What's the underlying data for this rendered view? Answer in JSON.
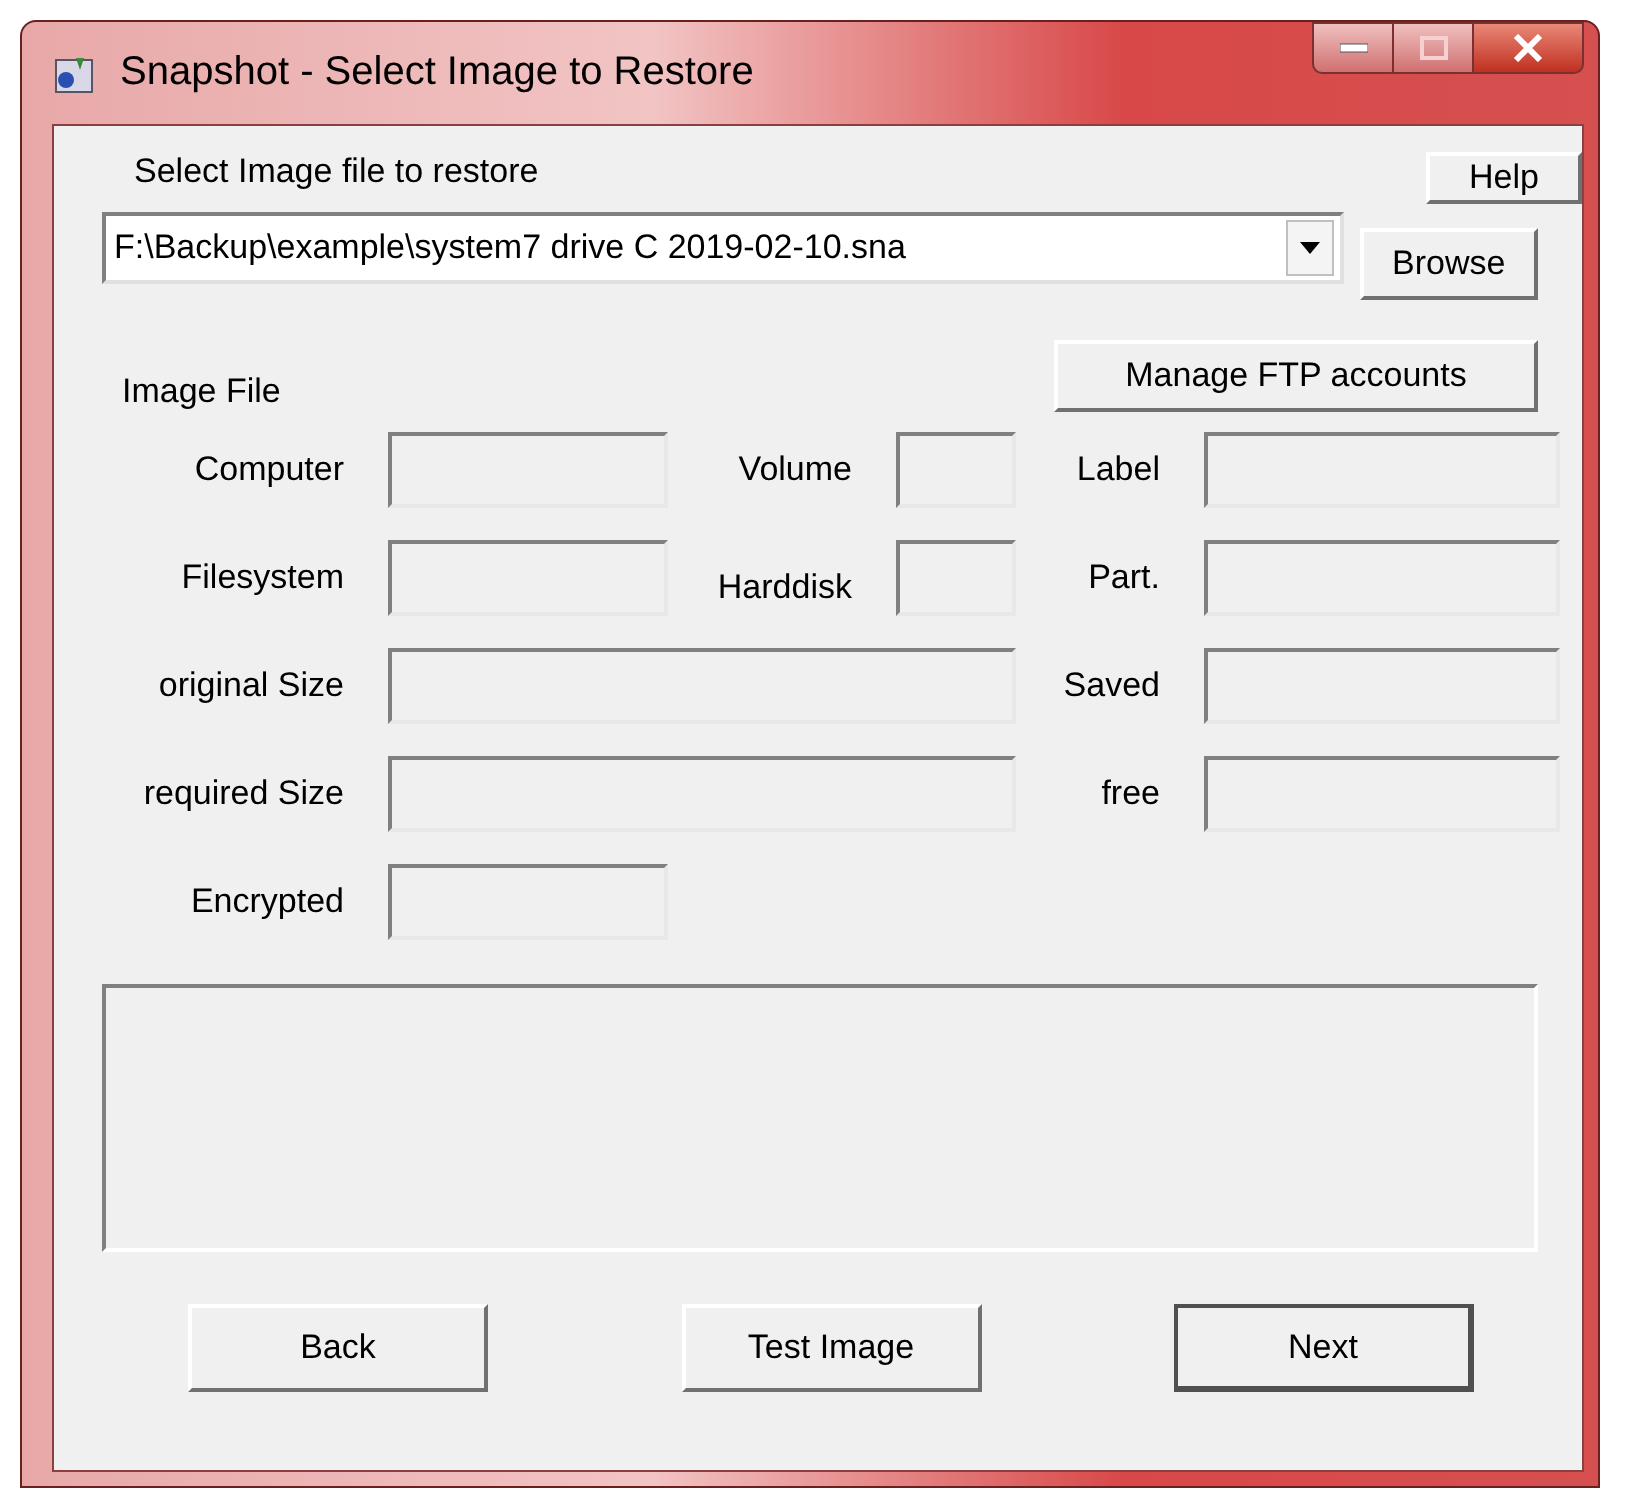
{
  "window": {
    "title": "Snapshot - Select Image to Restore"
  },
  "help_button": "Help",
  "image_select": {
    "label": "Select Image file to restore",
    "value": "F:\\Backup\\example\\system7 drive C 2019-02-10.sna"
  },
  "browse_button": "Browse",
  "ftp_button": "Manage FTP accounts",
  "section_label": "Image File",
  "rows": [
    {
      "fields": [
        {
          "label": "Computer"
        },
        {
          "label": "Volume"
        },
        {
          "label": "Label"
        }
      ]
    },
    {
      "fields": [
        {
          "label": "Filesystem"
        },
        {
          "label": "Harddisk"
        },
        {
          "label": "Part."
        }
      ]
    },
    {
      "fields": [
        {
          "label": "original Size"
        },
        {
          "label": "Saved"
        }
      ]
    },
    {
      "fields": [
        {
          "label": "required Size"
        },
        {
          "label": "free"
        }
      ]
    },
    {
      "fields": [
        {
          "label": "Encrypted"
        }
      ]
    }
  ],
  "buttons": [
    {
      "label": "Back",
      "default": false
    },
    {
      "label": "Test Image",
      "default": false
    },
    {
      "label": "Next",
      "default": true
    }
  ]
}
